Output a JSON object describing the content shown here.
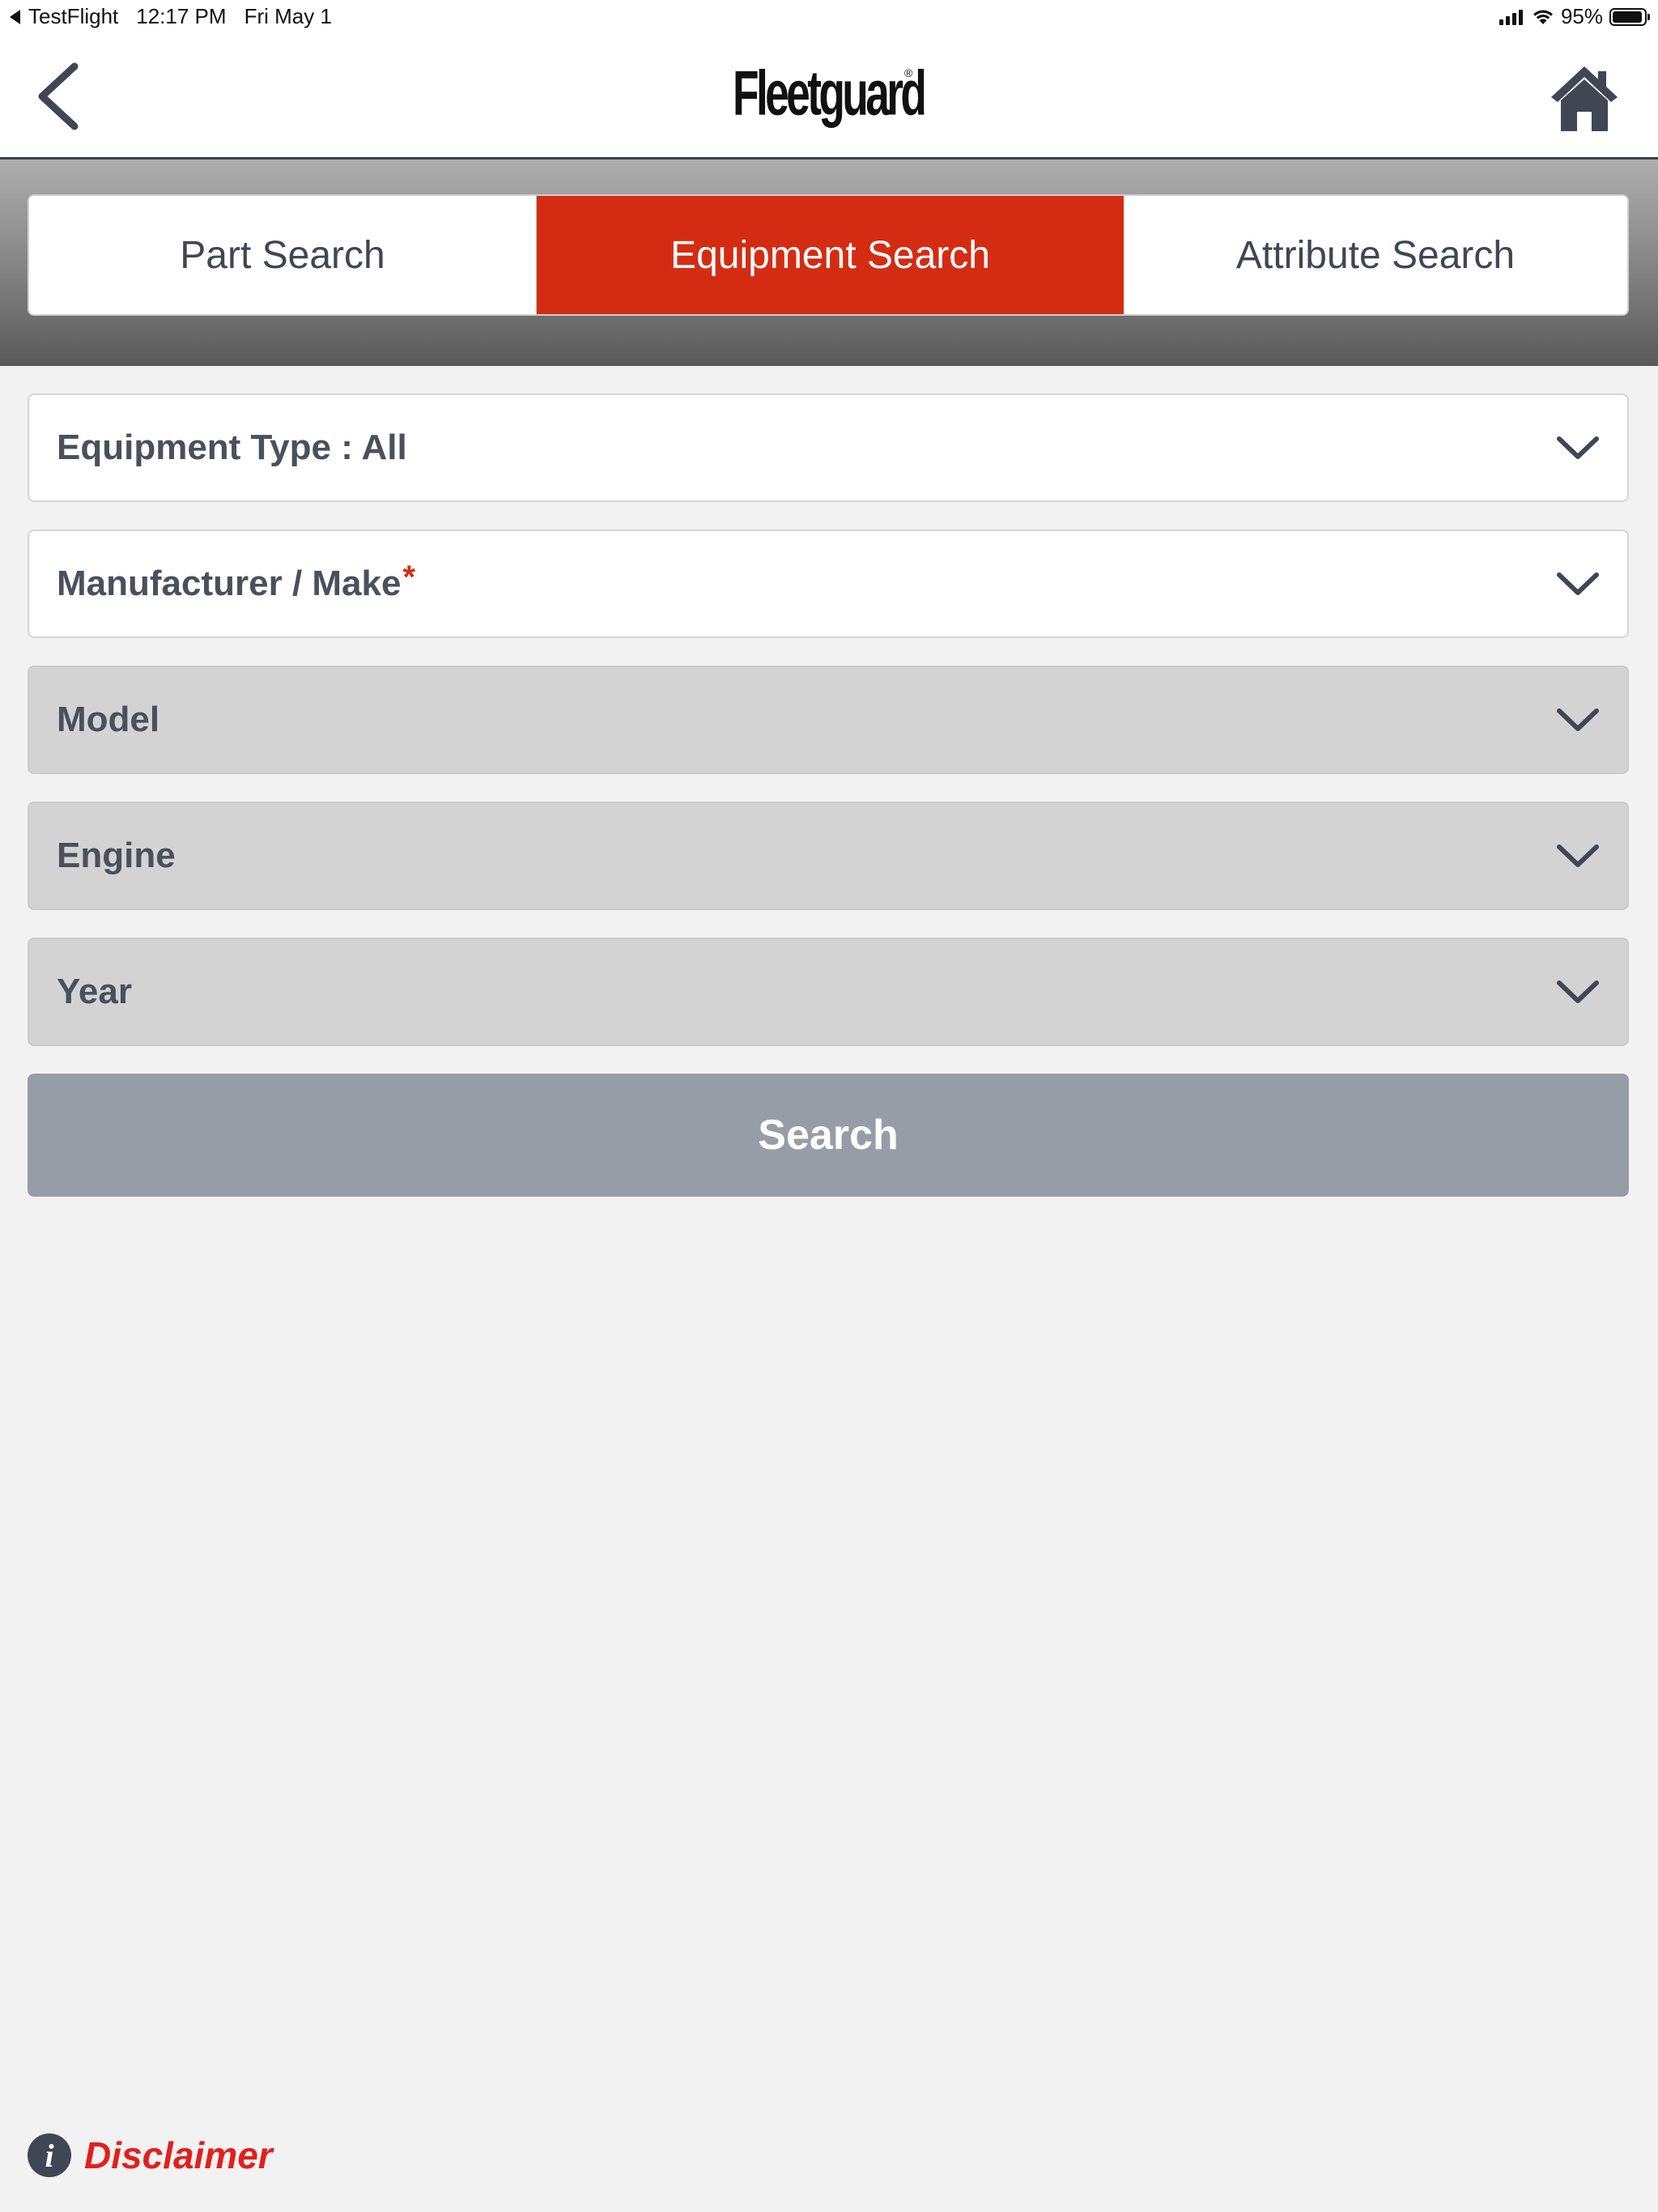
{
  "status_bar": {
    "back_app": "TestFlight",
    "time": "12:17 PM",
    "date": "Fri May 1",
    "battery": "95%"
  },
  "header": {
    "logo": "Fleetguard",
    "logo_mark": "®",
    "back_icon": "chevron-left-icon",
    "home_icon": "home-icon"
  },
  "tabs": [
    {
      "label": "Part Search",
      "active": false
    },
    {
      "label": "Equipment Search",
      "active": true
    },
    {
      "label": "Attribute Search",
      "active": false
    }
  ],
  "fields": [
    {
      "label": "Equipment Type : All",
      "required": false,
      "enabled": true
    },
    {
      "label": "Manufacturer / Make",
      "required": true,
      "required_mark": "*",
      "enabled": true
    },
    {
      "label": "Model",
      "required": false,
      "enabled": false
    },
    {
      "label": "Engine",
      "required": false,
      "enabled": false
    },
    {
      "label": "Year",
      "required": false,
      "enabled": false
    }
  ],
  "search_button": {
    "label": "Search",
    "enabled": false
  },
  "disclaimer": {
    "label": "Disclaimer",
    "icon": "info-icon",
    "icon_glyph": "i"
  },
  "colors": {
    "accent": "#d42c12",
    "text_primary": "#3f4654",
    "disabled_field": "#d3d3d3",
    "disabled_button": "#969da6",
    "disclaimer": "#e0201e"
  }
}
